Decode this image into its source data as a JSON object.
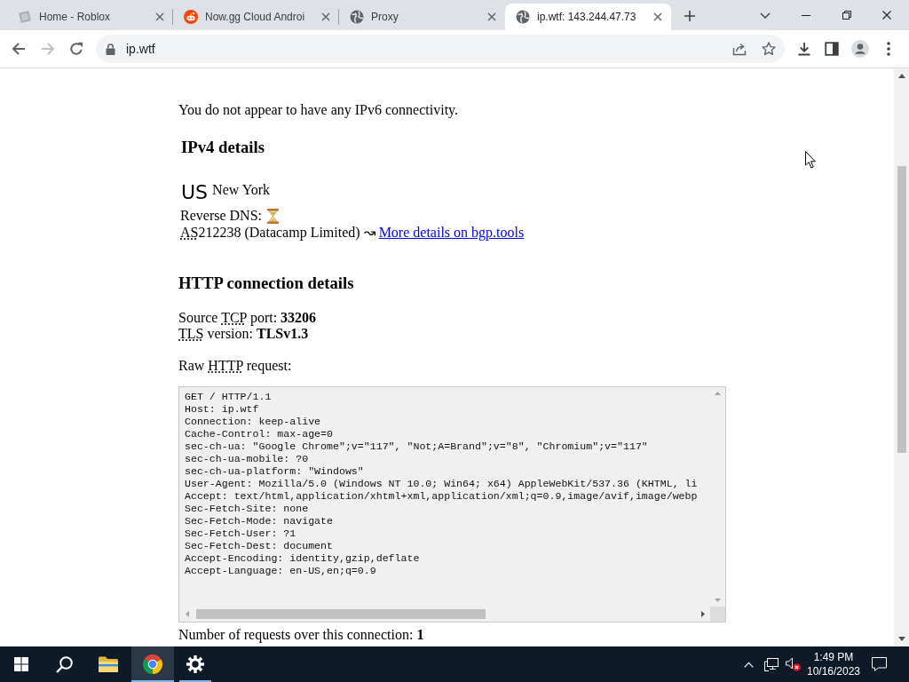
{
  "browser": {
    "tabs": [
      {
        "title": "Home - Roblox",
        "selected": false
      },
      {
        "title": "Now.gg Cloud Androi",
        "selected": false
      },
      {
        "title": "Proxy",
        "selected": false
      },
      {
        "title": "ip.wtf: 143.244.47.73",
        "selected": true
      }
    ],
    "nav_buttons": [
      {
        "disabled": false
      },
      {
        "disabled": true
      }
    ],
    "address": "ip.wtf"
  },
  "page": {
    "ipv6_message": "You do not appear to have any IPv6 connectivity.",
    "ipv4": {
      "heading": "IPv4 details",
      "country": "US",
      "city": "New York",
      "reverse_dns_label": "Reverse DNS:",
      "as_line": [
        {
          "kind": "abbr",
          "text": "AS"
        },
        {
          "kind": "text",
          "text": "212238 (Datacamp Limited) ↝"
        }
      ],
      "as_link": "More details on bgp.tools"
    },
    "http": {
      "heading": "HTTP connection details",
      "details": [
        {
          "segments": [
            {
              "kind": "text",
              "text": "Source "
            },
            {
              "kind": "abbr",
              "text": "TCP"
            },
            {
              "kind": "text",
              "text": " port: "
            },
            {
              "kind": "bold",
              "text": "33206"
            }
          ]
        },
        {
          "segments": [
            {
              "kind": "abbr",
              "text": "TLS"
            },
            {
              "kind": "text",
              "text": " version: "
            },
            {
              "kind": "bold",
              "text": "TLSv1.3"
            }
          ]
        }
      ],
      "raw_label": [
        {
          "kind": "text",
          "text": "Raw "
        },
        {
          "kind": "abbr",
          "text": "HTTP"
        },
        {
          "kind": "text",
          "text": " request:"
        }
      ],
      "raw_request": [
        "GET / HTTP/1.1",
        "Host: ip.wtf",
        "Connection: keep-alive",
        "Cache-Control: max-age=0",
        "sec-ch-ua: \"Google Chrome\";v=\"117\", \"Not;A=Brand\";v=\"8\", \"Chromium\";v=\"117\"",
        "sec-ch-ua-mobile: ?0",
        "sec-ch-ua-platform: \"Windows\"",
        "User-Agent: Mozilla/5.0 (Windows NT 10.0; Win64; x64) AppleWebKit/537.36 (KHTML, li",
        "Accept: text/html,application/xhtml+xml,application/xml;q=0.9,image/avif,image/webp",
        "Sec-Fetch-Site: none",
        "Sec-Fetch-Mode: navigate",
        "Sec-Fetch-User: ?1",
        "Sec-Fetch-Dest: document",
        "Accept-Encoding: identity,gzip,deflate",
        "Accept-Language: en-US,en;q=0.9"
      ],
      "request_count": [
        {
          "kind": "text",
          "text": "Number of requests over this connection: "
        },
        {
          "kind": "bold",
          "text": "1"
        }
      ]
    }
  },
  "taskbar": {
    "apps": [
      {
        "running": false,
        "selected": false
      },
      {
        "running": true,
        "selected": true
      },
      {
        "running": true,
        "selected": false
      }
    ],
    "time": "1:49 PM",
    "date": "10/16/2023"
  }
}
